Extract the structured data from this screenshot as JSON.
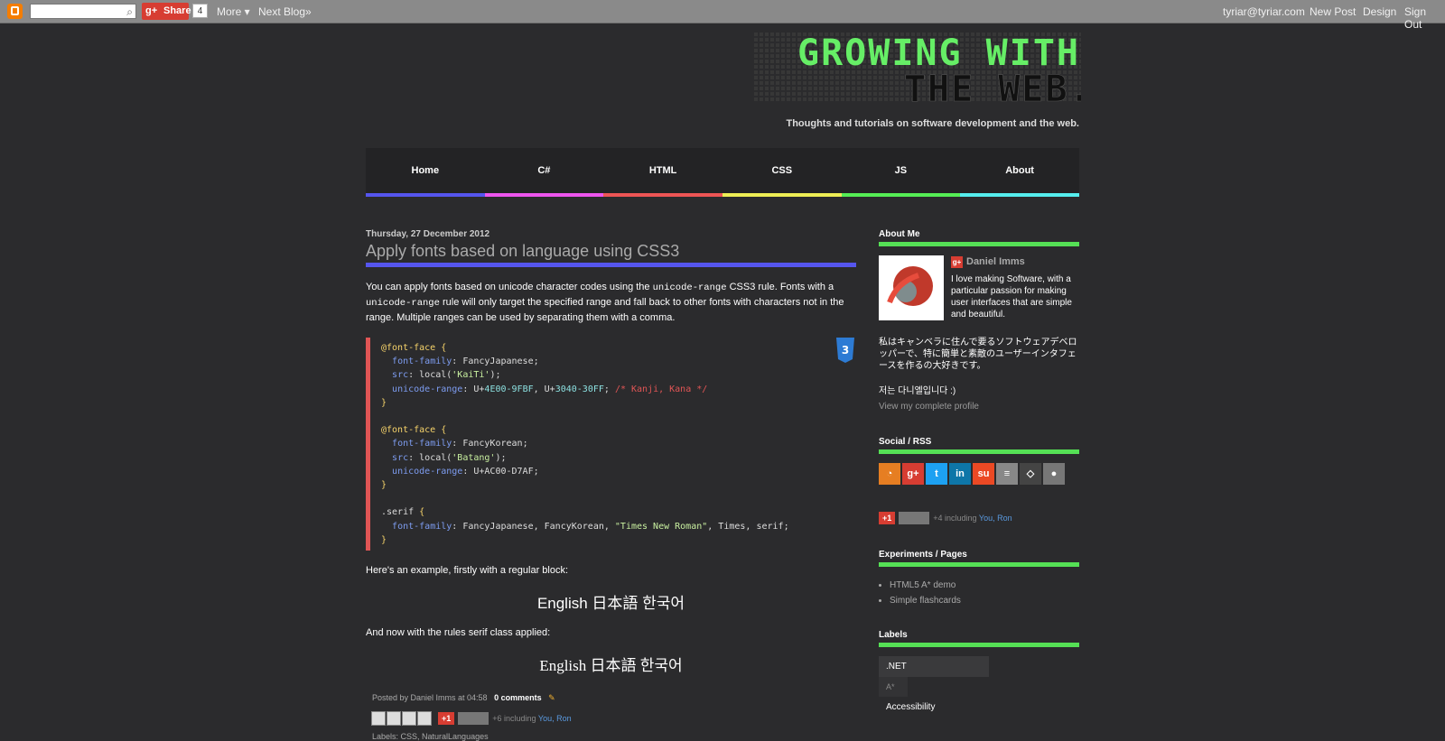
{
  "navbar": {
    "share_label": "Share",
    "share_count": "4",
    "more_label": "More ▾",
    "next_blog_label": "Next Blog»",
    "user_email": "tyriar@tyriar.com",
    "new_post_label": "New Post",
    "design_label": "Design",
    "sign_out_label": "Sign Out"
  },
  "header": {
    "title_line1": "GROWING WITH",
    "title_line2": "THE WEB.",
    "tagline": "Thoughts and tutorials on software development and the web."
  },
  "tabs": [
    {
      "label": "Home",
      "color": "#5555ee"
    },
    {
      "label": "C#",
      "color": "#ee55ee"
    },
    {
      "label": "HTML",
      "color": "#ee5555"
    },
    {
      "label": "CSS",
      "color": "#eeee55"
    },
    {
      "label": "JS",
      "color": "#55ee55"
    },
    {
      "label": "About",
      "color": "#55eeee"
    }
  ],
  "post": {
    "date": "Thursday, 27 December 2012",
    "title": "Apply fonts based on language using CSS3",
    "intro_1": "You can apply fonts based on unicode character codes using the ",
    "intro_code1": "unicode-range",
    "intro_2": " CSS3 rule. Fonts with a ",
    "intro_code2": "unicode-range",
    "intro_3": " rule will only target the specified range and fall back to other fonts with characters not in the range. Multiple ranges can be used by separating them with a comma.",
    "example_regular_text": "Here's an example, firstly with a regular block:",
    "sample_text": "English 日本語 한국어",
    "example_serif_text": "And now with the rules serif class applied:",
    "posted_by": "Posted by Daniel Imms at 04:58",
    "comments": "0 comments",
    "plus_text": "+6 including ",
    "plus_names": "You, Ron",
    "gplus_label": "+1",
    "labels_line": "Labels: CSS, NaturalLanguages"
  },
  "code": {
    "block1": {
      "at": "@font-face",
      "family_prop": "font-family",
      "family_val": "FancyJapanese",
      "src_prop": "src",
      "src_val": "'KaiTi'",
      "range_prop": "unicode-range",
      "range_val1": "4E00-9FBF",
      "range_val2": "3040-30FF",
      "comment": "/* Kanji, Kana */"
    },
    "block2": {
      "at": "@font-face",
      "family_prop": "font-family",
      "family_val": "FancyKorean",
      "src_prop": "src",
      "src_val": "'Batang'",
      "range_prop": "unicode-range",
      "range_val": "U+AC00-D7AF"
    },
    "block3": {
      "selector": ".serif",
      "family_prop": "font-family",
      "family_val1": "FancyJapanese, FancyKorean, ",
      "family_str": "\"Times New Roman\"",
      "family_val2": ", Times, serif"
    },
    "badge": "3"
  },
  "sidebar": {
    "about_title": "About Me",
    "profile_name": "Daniel Imms",
    "bio": "I love making Software, with a particular passion for making user interfaces that are simple and beautiful.",
    "jp_text": "私はキャンベラに住んで要るソフトウェアデベロッパーで、特に簡単と素敵のユーザーインタフェースを作るの大好きです。",
    "kr_text": "저는 다니엘입니다 :)",
    "view_profile": "View my complete profile",
    "social_title": "Social / RSS",
    "social_icons": [
      {
        "name": "rss-icon",
        "glyph": "◔",
        "color": "#e67e22"
      },
      {
        "name": "google-plus-icon",
        "glyph": "g+",
        "color": "#d73d32"
      },
      {
        "name": "twitter-icon",
        "glyph": "t",
        "color": "#1da1f2"
      },
      {
        "name": "linkedin-icon",
        "glyph": "in",
        "color": "#0e76a8"
      },
      {
        "name": "stumbleupon-icon",
        "glyph": "su",
        "color": "#eb4924"
      },
      {
        "name": "stackoverflow-icon",
        "glyph": "≡",
        "color": "#888888"
      },
      {
        "name": "codepen-icon",
        "glyph": "◇",
        "color": "#444444"
      },
      {
        "name": "github-icon",
        "glyph": "●",
        "color": "#777777"
      }
    ],
    "plus_text": "+4 including ",
    "plus_names": "You, Ron",
    "gplus_label": "+1",
    "experiments_title": "Experiments / Pages",
    "experiments": [
      "HTML5 A* demo",
      "Simple flashcards"
    ],
    "labels_title": "Labels",
    "labels": [
      ".NET",
      "A*",
      "Accessibility"
    ]
  }
}
